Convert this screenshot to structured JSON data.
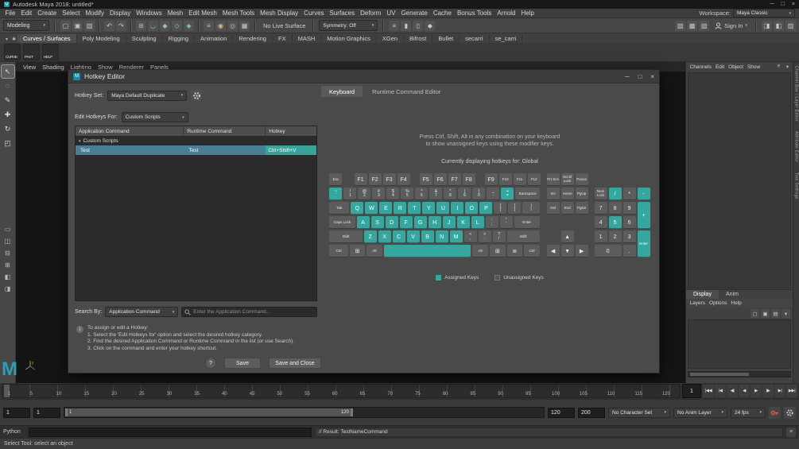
{
  "window": {
    "title": "Autodesk Maya 2018: untitled*",
    "controls": {
      "min": "─",
      "max": "□",
      "close": "×"
    }
  },
  "menu_bar": {
    "items": [
      "File",
      "Edit",
      "Create",
      "Select",
      "Modify",
      "Display",
      "Windows",
      "Mesh",
      "Edit Mesh",
      "Mesh Tools",
      "Mesh Display",
      "Curves",
      "Surfaces",
      "Deform",
      "UV",
      "Generate",
      "Cache",
      "Bonus Tools",
      "Arnold",
      "Help"
    ],
    "workspace_label": "Workspace:",
    "workspace_value": "Maya Classic"
  },
  "status_line": {
    "menu_set": "Modeling",
    "no_live_surface": "No Live Surface",
    "symmetry_label": "Symmetry:",
    "symmetry_value": "Off",
    "sign_in": "Sign In",
    "left_groups": [
      [
        {
          "n": "new-scene-icon",
          "g": "▢"
        },
        {
          "n": "open-scene-icon",
          "g": "▣"
        },
        {
          "n": "save-scene-icon",
          "g": "▥"
        }
      ],
      [
        {
          "n": "undo-icon",
          "g": "↶"
        },
        {
          "n": "redo-icon",
          "g": "↷"
        }
      ],
      [
        {
          "n": "snap-grid-icon",
          "g": "⊞",
          "c": "#8fc3d6"
        },
        {
          "n": "snap-curve-icon",
          "g": "◡",
          "c": "#8fc3d6"
        },
        {
          "n": "snap-point-icon",
          "g": "◆",
          "c": "#8fc3d6"
        },
        {
          "n": "snap-plane-icon",
          "g": "◇",
          "c": "#8fc3d6"
        },
        {
          "n": "make-live-icon",
          "g": "◈",
          "c": "#8fd6c3"
        }
      ],
      [
        {
          "n": "construction-history-icon",
          "g": "≡"
        },
        {
          "n": "render-icon",
          "g": "◉",
          "c": "#d6b98f"
        },
        {
          "n": "ipr-render-icon",
          "g": "◎",
          "c": "#d6b98f"
        },
        {
          "n": "render-settings-icon",
          "g": "▦"
        }
      ]
    ],
    "mid_groups": [
      [
        {
          "n": "select-hierarchy-icon",
          "g": "≡"
        },
        {
          "n": "select-object-icon",
          "g": "▮"
        },
        {
          "n": "select-component-icon",
          "g": "▯"
        },
        {
          "n": "selection-mask-icon",
          "g": "◆"
        }
      ]
    ],
    "right_groups": [
      [
        {
          "n": "highlight-selection-toggle",
          "g": "▧"
        },
        {
          "n": "wireframe-toggle",
          "g": "▩"
        },
        {
          "n": "xray-toggle",
          "g": "▨"
        }
      ],
      [
        {
          "n": "attribute-editor-toggle",
          "g": "◨"
        },
        {
          "n": "tool-settings-toggle",
          "g": "◧"
        },
        {
          "n": "channel-box-toggle",
          "g": "▥"
        }
      ]
    ]
  },
  "shelf": {
    "tabs": [
      "Curves / Surfaces",
      "Poly Modeling",
      "Sculpting",
      "Rigging",
      "Animation",
      "Rendering",
      "FX",
      "MASH",
      "Motion Graphics",
      "XGen",
      "Bifrost",
      "Bullet",
      "secarri",
      "se_carri"
    ],
    "items": [
      "CURVE",
      "PAST",
      "HELP"
    ]
  },
  "toolbox": {
    "tools": [
      {
        "n": "select-tool",
        "g": "↖"
      },
      {
        "n": "lasso-select-tool",
        "g": "◌"
      },
      {
        "n": "paint-select-tool",
        "g": "✎"
      },
      {
        "n": "move-tool",
        "g": "✚"
      },
      {
        "n": "rotate-tool",
        "g": "↻"
      },
      {
        "n": "scale-tool",
        "g": "◰"
      }
    ],
    "layouts": [
      {
        "n": "layout-single-pane",
        "g": "▭"
      },
      {
        "n": "layout-two-pane-side",
        "g": "◫"
      },
      {
        "n": "layout-two-pane-stacked",
        "g": "⊟"
      },
      {
        "n": "layout-four-pane",
        "g": "⊞"
      },
      {
        "n": "layout-persp-outliner",
        "g": "◧"
      },
      {
        "n": "layout-hypershade-persp",
        "g": "◨"
      }
    ]
  },
  "panel_menu": {
    "items": [
      "View",
      "Shading",
      "Lighting",
      "Show",
      "Renderer",
      "Panels"
    ]
  },
  "hotkey_editor": {
    "window_title": "Hotkey Editor",
    "hotkey_set_label": "Hotkey Set:",
    "hotkey_set_value": "Maya Default Duplicate",
    "edit_hotkeys_label": "Edit Hotkeys For:",
    "edit_hotkeys_value": "Custom Scripts",
    "table": {
      "columns": [
        "Application Command",
        "Runtime Command",
        "Hotkey"
      ],
      "group": "Custom Scripts",
      "rows": [
        {
          "app": "Test",
          "runtime": "Test",
          "hotkey": "Ctrl+Shift+V"
        }
      ]
    },
    "search_by_label": "Search By:",
    "search_by_value": "Application Command",
    "search_placeholder": "Enter the Application Command...",
    "tabs": [
      "Keyboard",
      "Runtime Command Editor"
    ],
    "hint_line1": "Press Ctrl, Shift, Alt in any combination on your keyboard",
    "hint_line2": "to show unassigned keys using these modifier keys.",
    "current_context": "Currently displaying hotkeys for: Global",
    "legend": {
      "assigned": "Assigned Keys",
      "unassigned": "Unassigned Keys"
    },
    "info": {
      "title": "To assign or edit a Hotkey:",
      "steps": [
        "1. Select the 'Edit Hotkeys for' option and select the desired hotkey category.",
        "2. Find the desired Application Command or Runtime Command in the list (or use Search).",
        "3. Click on the command and enter your hotkey shortcut."
      ]
    },
    "buttons": {
      "help": "?",
      "save": "Save",
      "save_and_close": "Save and Close"
    },
    "keyboard": {
      "accent_assigned": "#35a79f",
      "accent_unassigned": "#5c5c5c",
      "main_rows": [
        [
          {
            "l": "Esc",
            "w": 1
          },
          {
            "g": 0.7
          },
          {
            "l": "F1"
          },
          {
            "l": "F2"
          },
          {
            "l": "F3"
          },
          {
            "l": "F4"
          },
          {
            "g": 0.5
          },
          {
            "l": "F5"
          },
          {
            "l": "F6"
          },
          {
            "l": "F7"
          },
          {
            "l": "F8"
          },
          {
            "g": 0.5
          },
          {
            "l": "F9"
          },
          {
            "l": "F10"
          },
          {
            "l": "F11"
          },
          {
            "l": "F12"
          }
        ],
        [
          {
            "t": "~",
            "l": "`",
            "s": 1
          },
          {
            "t": "!",
            "l": "1"
          },
          {
            "t": "@",
            "l": "2"
          },
          {
            "t": "#",
            "l": "3"
          },
          {
            "t": "$",
            "l": "4"
          },
          {
            "t": "%",
            "l": "5"
          },
          {
            "t": "^",
            "l": "6"
          },
          {
            "t": "&",
            "l": "7"
          },
          {
            "t": "*",
            "l": "8"
          },
          {
            "t": "(",
            "l": "9"
          },
          {
            "t": ")",
            "l": "0"
          },
          {
            "t": "_",
            "l": "-"
          },
          {
            "t": "+",
            "l": "=",
            "s": 1
          },
          {
            "l": "Backspace",
            "w": 1.8,
            "n": "key-backspace"
          }
        ],
        [
          {
            "l": "Tab",
            "w": 1.5
          },
          {
            "l": "Q",
            "s": 1
          },
          {
            "l": "W",
            "s": 1
          },
          {
            "l": "E",
            "s": 1
          },
          {
            "l": "R",
            "s": 1
          },
          {
            "l": "T",
            "s": 1
          },
          {
            "l": "Y",
            "s": 1
          },
          {
            "l": "U",
            "s": 1
          },
          {
            "l": "I",
            "s": 1
          },
          {
            "l": "O",
            "s": 1
          },
          {
            "l": "P",
            "s": 1
          },
          {
            "t": "{",
            "l": "["
          },
          {
            "t": "}",
            "l": "]"
          },
          {
            "t": "|",
            "l": "\\",
            "w": 1.3,
            "n": "key-backslash"
          }
        ],
        [
          {
            "l": "Caps Lock",
            "w": 1.9,
            "n": "key-caps-lock"
          },
          {
            "l": "A",
            "s": 1
          },
          {
            "l": "S",
            "s": 1
          },
          {
            "l": "D",
            "s": 1
          },
          {
            "l": "F",
            "s": 1
          },
          {
            "l": "G",
            "s": 1
          },
          {
            "l": "H",
            "s": 1
          },
          {
            "l": "J",
            "s": 1
          },
          {
            "l": "K",
            "s": 1
          },
          {
            "l": "L",
            "s": 1
          },
          {
            "t": ":",
            "l": ";",
            "n": "key-semicolon"
          },
          {
            "t": "\"",
            "l": "'",
            "n": "key-quote"
          },
          {
            "l": "Enter",
            "w": 1.9,
            "n": "key-enter"
          }
        ],
        [
          {
            "l": "Shift",
            "w": 2.4,
            "n": "key-shift-left"
          },
          {
            "l": "Z",
            "s": 1
          },
          {
            "l": "X",
            "s": 1
          },
          {
            "l": "C",
            "s": 1
          },
          {
            "l": "V",
            "s": 1
          },
          {
            "l": "B",
            "s": 1
          },
          {
            "l": "N",
            "s": 1
          },
          {
            "l": "M",
            "s": 1
          },
          {
            "t": "<",
            "l": ",",
            "n": "key-comma"
          },
          {
            "t": ">",
            "l": ".",
            "n": "key-period"
          },
          {
            "t": "?",
            "l": "/",
            "n": "key-slash"
          },
          {
            "l": "Shift",
            "w": 2.4,
            "n": "key-shift-right"
          }
        ],
        [
          {
            "l": "Ctrl",
            "w": 1.4,
            "n": "key-ctrl-left"
          },
          {
            "l": "⊞",
            "w": 1.2,
            "n": "key-win-left"
          },
          {
            "l": "Alt",
            "w": 1.2,
            "n": "key-alt-left"
          },
          {
            "l": " ",
            "w": 6.2,
            "s": 1,
            "n": "key-space"
          },
          {
            "l": "Alt",
            "w": 1.2,
            "n": "key-alt-right"
          },
          {
            "l": "⊞",
            "w": 1.2,
            "n": "key-win-right"
          },
          {
            "l": "≣",
            "w": 1.2,
            "n": "key-menu"
          },
          {
            "l": "Ctrl",
            "w": 1.2,
            "n": "key-ctrl-right"
          }
        ]
      ],
      "nav_keys": [
        {
          "l": "Prt Scn",
          "r": 1,
          "c": 1,
          "n": "key-print-screen"
        },
        {
          "l": "Scroll Lock",
          "r": 1,
          "c": 2,
          "n": "key-scroll-lock"
        },
        {
          "l": "Pause",
          "r": 1,
          "c": 3,
          "n": "key-pause"
        },
        {
          "l": "Ins",
          "r": 2,
          "c": 1,
          "n": "key-insert"
        },
        {
          "l": "Home",
          "r": 2,
          "c": 2,
          "n": "key-home"
        },
        {
          "l": "PgUp",
          "r": 2,
          "c": 3,
          "n": "key-page-up"
        },
        {
          "l": "Del",
          "r": 3,
          "c": 1,
          "n": "key-delete"
        },
        {
          "l": "End",
          "r": 3,
          "c": 2,
          "n": "key-end"
        },
        {
          "l": "PgDn",
          "r": 3,
          "c": 3,
          "n": "key-page-down"
        },
        {
          "l": "▲",
          "r": 5,
          "c": 2,
          "n": "key-arrow-up"
        },
        {
          "l": "◀",
          "r": 6,
          "c": 1,
          "n": "key-arrow-left"
        },
        {
          "l": "▼",
          "r": 6,
          "c": 2,
          "n": "key-arrow-down"
        },
        {
          "l": "▶",
          "r": 6,
          "c": 3,
          "n": "key-arrow-right"
        }
      ],
      "numpad_keys": [
        {
          "l": "Num Lock",
          "r": 2,
          "c": 1,
          "n": "key-num-lock"
        },
        {
          "l": "/",
          "r": 2,
          "c": 2,
          "s": 1,
          "n": "key-numpad-divide"
        },
        {
          "l": "*",
          "r": 2,
          "c": 3,
          "n": "key-numpad-multiply"
        },
        {
          "l": "-",
          "r": 2,
          "c": 4,
          "s": 1,
          "n": "key-numpad-subtract"
        },
        {
          "l": "7",
          "r": 3,
          "c": 1,
          "n": "key-numpad-7"
        },
        {
          "l": "8",
          "r": 3,
          "c": 2,
          "n": "key-numpad-8"
        },
        {
          "l": "9",
          "r": 3,
          "c": 3,
          "n": "key-numpad-9"
        },
        {
          "l": "+",
          "r": 3,
          "c": 4,
          "rs": 2,
          "s": 1,
          "n": "key-numpad-add"
        },
        {
          "l": "4",
          "r": 4,
          "c": 1,
          "n": "key-numpad-4"
        },
        {
          "l": "5",
          "r": 4,
          "c": 2,
          "s": 1,
          "n": "key-numpad-5"
        },
        {
          "l": "6",
          "r": 4,
          "c": 3,
          "n": "key-numpad-6"
        },
        {
          "l": "1",
          "r": 5,
          "c": 1,
          "n": "key-numpad-1"
        },
        {
          "l": "2",
          "r": 5,
          "c": 2,
          "n": "key-numpad-2"
        },
        {
          "l": "3",
          "r": 5,
          "c": 3,
          "n": "key-numpad-3"
        },
        {
          "l": "Enter",
          "r": 5,
          "c": 4,
          "rs": 2,
          "s": 1,
          "n": "key-numpad-enter"
        },
        {
          "l": "0",
          "r": 6,
          "c": 1,
          "cs": 2,
          "n": "key-numpad-0"
        },
        {
          "l": ".",
          "r": 6,
          "c": 3,
          "n": "key-numpad-decimal"
        }
      ]
    }
  },
  "channel_box": {
    "menus": [
      "Channels",
      "Edit",
      "Object",
      "Show"
    ],
    "header_icons": [
      {
        "n": "channel-manipulator-icon",
        "g": "≡"
      },
      {
        "n": "channel-speed-icon",
        "g": "▾"
      }
    ],
    "tabs": [
      "Display",
      "Anim"
    ],
    "layer_menus": [
      "Layers",
      "Options",
      "Help"
    ],
    "layer_icons": [
      {
        "n": "layer-toggle-icon",
        "g": "▢"
      },
      {
        "n": "new-empty-layer-icon",
        "g": "▣"
      },
      {
        "n": "new-layer-from-selected-icon",
        "g": "▤"
      },
      {
        "n": "layer-sort-icon",
        "g": "▾"
      }
    ]
  },
  "right_sidebar": {
    "tabs": [
      "Channel Box / Layer Editor",
      "Attribute Editor",
      "Tool Settings"
    ]
  },
  "timeline": {
    "min": 1,
    "max": 120,
    "current": "1",
    "labels": [
      1,
      5,
      10,
      15,
      20,
      25,
      30,
      35,
      40,
      45,
      50,
      55,
      60,
      65,
      70,
      75,
      80,
      85,
      90,
      95,
      100,
      105,
      110,
      115,
      120
    ],
    "playback": [
      {
        "n": "go-to-start-button",
        "g": "|◀◀"
      },
      {
        "n": "step-back-frame-button",
        "g": "|◀"
      },
      {
        "n": "step-back-key-button",
        "g": "◀|"
      },
      {
        "n": "play-backwards-button",
        "g": "◀"
      },
      {
        "n": "play-forwards-button",
        "g": "▶"
      },
      {
        "n": "step-forward-key-button",
        "g": "|▶"
      },
      {
        "n": "step-forward-frame-button",
        "g": "▶|"
      },
      {
        "n": "go-to-end-button",
        "g": "▶▶|"
      }
    ]
  },
  "range": {
    "start": "1",
    "range_start": "1",
    "bar_left": "1",
    "bar_right": "120",
    "range_end": "120",
    "end": "200",
    "character_set": "No Character Set",
    "anim_layer": "No Anim Layer",
    "fps": "24 fps"
  },
  "command_line": {
    "language": "Python",
    "result": "// Result: TestNameCommand"
  },
  "help_line": {
    "text": "Select Tool: select an object"
  }
}
